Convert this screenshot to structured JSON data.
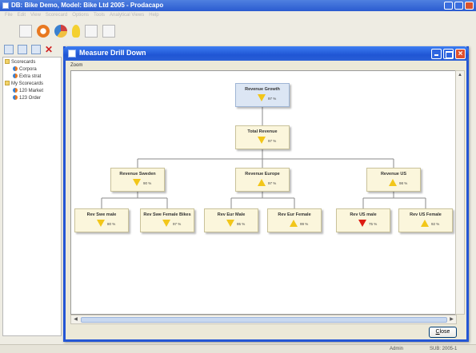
{
  "main_window": {
    "title": "DB: Bike Demo, Model: Bike Ltd 2005 - Prodacapo",
    "menu": [
      "File",
      "Edit",
      "View",
      "Scorecard",
      "Options",
      "Tools",
      "Analytical Views",
      "Help"
    ],
    "tree": [
      {
        "label": "Scorecards",
        "icon": "folder-icon"
      },
      {
        "label": "Corpora",
        "icon": "scorecard-icon"
      },
      {
        "label": "Extra strat",
        "icon": "scorecard-icon"
      },
      {
        "label": "My Scorecards",
        "icon": "folder-icon"
      },
      {
        "label": "120 Market",
        "icon": "scorecard-icon"
      },
      {
        "label": "123 Order",
        "icon": "scorecard-icon"
      }
    ],
    "status": {
      "user": "Admin",
      "period": "SUB: 2005-1"
    }
  },
  "dialog": {
    "title": "Measure Drill Down",
    "zoom_label": "Zoom",
    "close_label_underlined": "C",
    "close_label_rest": "lose"
  },
  "drill_tree": {
    "root": {
      "label": "Revenue Growth",
      "indicator": "down",
      "color": "#f2c619",
      "percent": "97 %"
    },
    "level1": {
      "label": "Total Revenue",
      "indicator": "down",
      "color": "#f2c619",
      "percent": "97 %"
    },
    "level2": [
      {
        "label": "Revenue Sweden",
        "indicator": "down",
        "color": "#f2c619",
        "percent": "90 %"
      },
      {
        "label": "Revenue Europe",
        "indicator": "up",
        "color": "#f2c619",
        "percent": "97 %"
      },
      {
        "label": "Revenue US",
        "indicator": "up",
        "color": "#f2c619",
        "percent": "98 %"
      }
    ],
    "level3": [
      {
        "label": "Rev Swe male",
        "indicator": "down",
        "color": "#f2c619",
        "percent": "80 %"
      },
      {
        "label": "Rev Swe Female Bikes",
        "indicator": "down",
        "color": "#f2c619",
        "percent": "97 %"
      },
      {
        "label": "Rev Eur Male",
        "indicator": "down",
        "color": "#f2c619",
        "percent": "95 %"
      },
      {
        "label": "Rev Eur Female",
        "indicator": "up",
        "color": "#f2c619",
        "percent": "99 %"
      },
      {
        "label": "Rev US male",
        "indicator": "down",
        "color": "#dd1b12",
        "percent": "75 %"
      },
      {
        "label": "Rev US Female",
        "indicator": "up",
        "color": "#f2c619",
        "percent": "92 %"
      }
    ]
  }
}
